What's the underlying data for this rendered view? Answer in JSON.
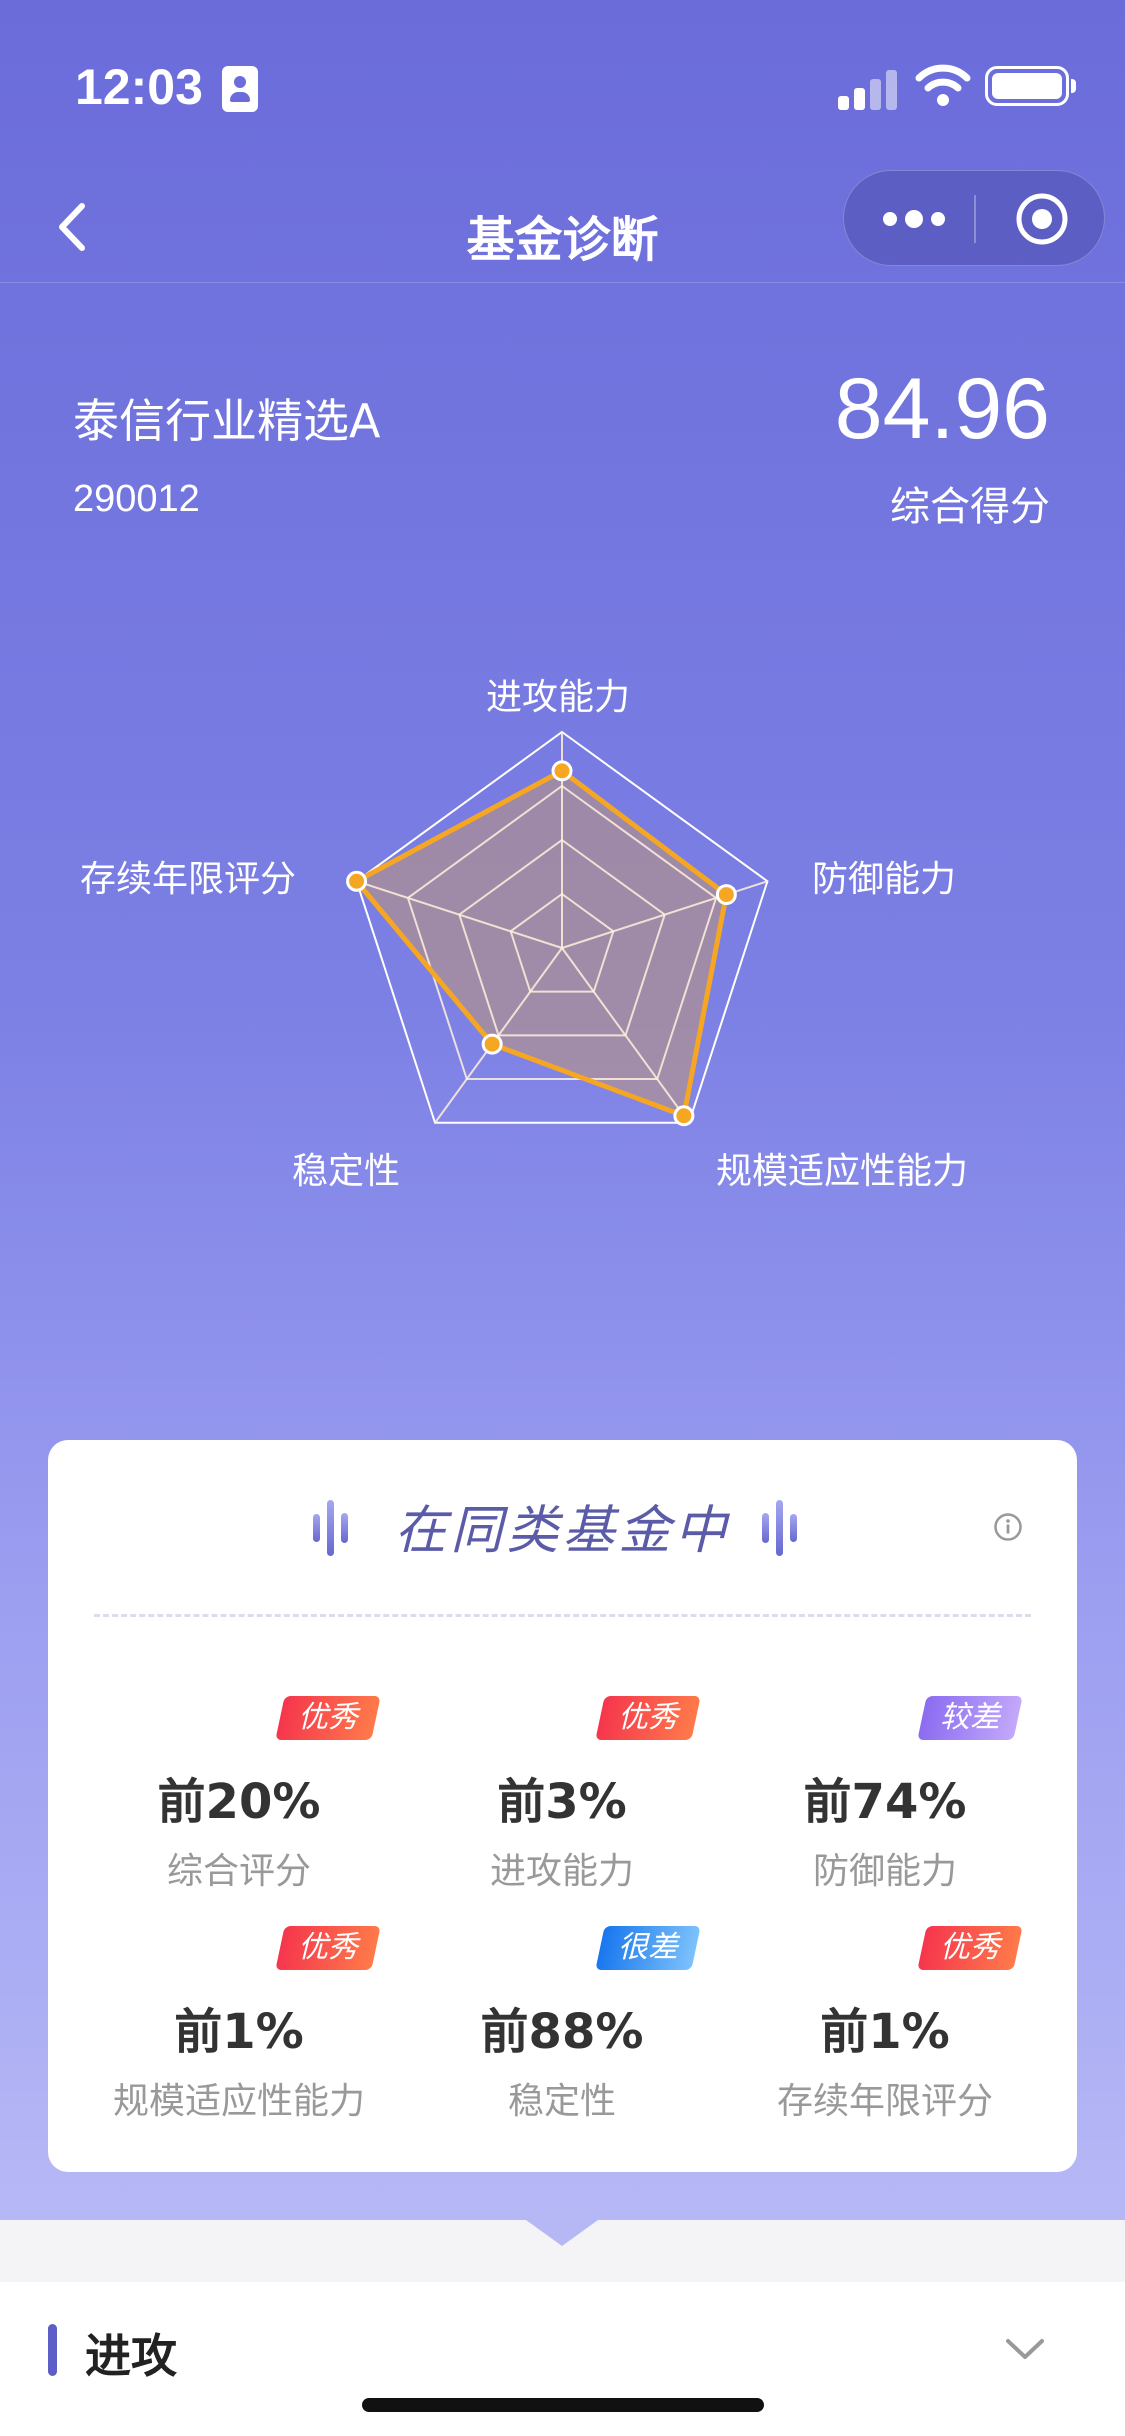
{
  "status": {
    "time": "12:03"
  },
  "nav": {
    "title": "基金诊断"
  },
  "fund": {
    "name": "泰信行业精选A",
    "code": "290012",
    "score": "84.96",
    "score_label": "综合得分"
  },
  "radar": {
    "axes": [
      "进攻能力",
      "防御能力",
      "规模适应性能力",
      "稳定性",
      "存续年限评分"
    ],
    "values": [
      0.82,
      0.8,
      0.96,
      0.55,
      1.0
    ],
    "colors": {
      "line": "#f5a623",
      "fill": "rgba(190,150,120,0.55)",
      "grid": "#ffffff"
    }
  },
  "card": {
    "title": "在同类基金中",
    "items": [
      {
        "pct": "前20%",
        "label": "综合评分",
        "badge": "优秀",
        "badge_color": "#f0394a"
      },
      {
        "pct": "前3%",
        "label": "进攻能力",
        "badge": "优秀",
        "badge_color": "#f0394a"
      },
      {
        "pct": "前74%",
        "label": "防御能力",
        "badge": "较差",
        "badge_color": "#8f7cf3"
      },
      {
        "pct": "前1%",
        "label": "规模适应性能力",
        "badge": "优秀",
        "badge_color": "#f0394a"
      },
      {
        "pct": "前88%",
        "label": "稳定性",
        "badge": "很差",
        "badge_color": "#2a8ef0"
      },
      {
        "pct": "前1%",
        "label": "存续年限评分",
        "badge": "优秀",
        "badge_color": "#f0394a"
      }
    ]
  },
  "section": {
    "title": "进攻"
  }
}
